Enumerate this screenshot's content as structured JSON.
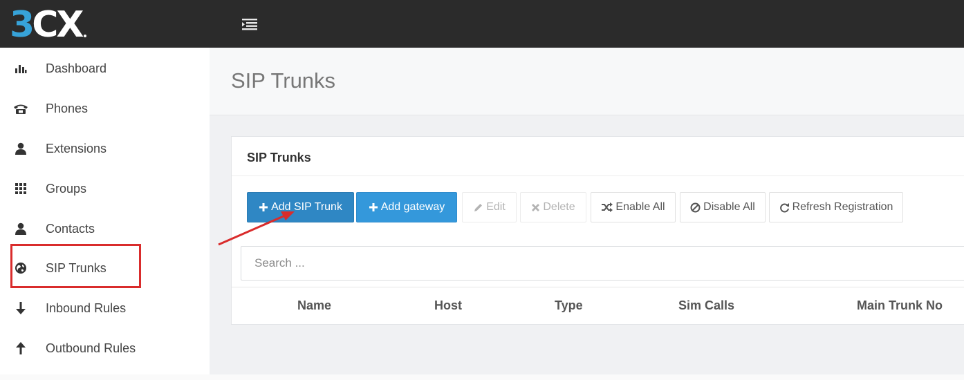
{
  "app": {
    "logo_prefix": "3",
    "logo_suffix": "CX"
  },
  "sidebar": {
    "items": [
      {
        "label": "Dashboard",
        "icon": "bar-chart-icon"
      },
      {
        "label": "Phones",
        "icon": "phone-icon"
      },
      {
        "label": "Extensions",
        "icon": "user-icon"
      },
      {
        "label": "Groups",
        "icon": "grid-icon"
      },
      {
        "label": "Contacts",
        "icon": "user-icon"
      },
      {
        "label": "SIP Trunks",
        "icon": "globe-icon"
      },
      {
        "label": "Inbound Rules",
        "icon": "arrow-down-icon"
      },
      {
        "label": "Outbound Rules",
        "icon": "arrow-up-icon"
      }
    ],
    "highlighted_item": "SIP Trunks"
  },
  "page": {
    "title": "SIP Trunks"
  },
  "panel": {
    "title": "SIP Trunks",
    "toolbar": {
      "add_sip_trunk": "Add SIP Trunk",
      "add_gateway": "Add gateway",
      "edit": "Edit",
      "delete": "Delete",
      "enable_all": "Enable All",
      "disable_all": "Disable All",
      "refresh_registration": "Refresh Registration"
    },
    "search": {
      "placeholder": "Search ...",
      "value": ""
    },
    "table": {
      "columns": [
        "Name",
        "Host",
        "Type",
        "Sim Calls",
        "Main Trunk No"
      ]
    }
  },
  "colors": {
    "topbar": "#2b2b2b",
    "logo_blue": "#37a3d9",
    "primary_button": "#2f87c4",
    "info_button": "#3498db",
    "annotation_red": "#d92c2c"
  }
}
